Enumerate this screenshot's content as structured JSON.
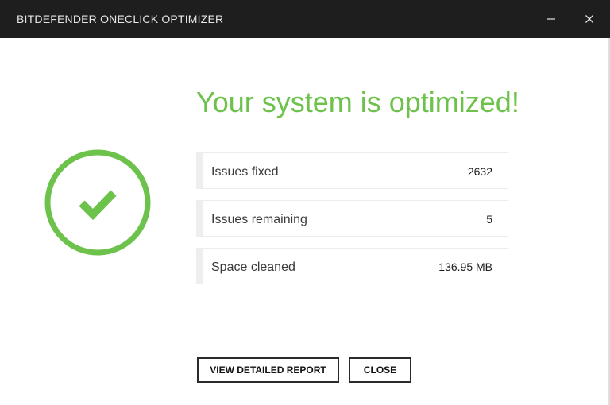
{
  "window": {
    "title": "BITDEFENDER ONECLICK OPTIMIZER",
    "minimize_icon": "minimize-icon",
    "close_icon": "close-icon"
  },
  "main": {
    "headline": "Your system is optimized!",
    "status_icon": "checkmark-circle-icon",
    "stats": [
      {
        "label": "Issues fixed",
        "value": "2632"
      },
      {
        "label": "Issues remaining",
        "value": "5"
      },
      {
        "label": "Space cleaned",
        "value": "136.95 MB"
      }
    ]
  },
  "actions": {
    "report_label": "VIEW DETAILED REPORT",
    "close_label": "CLOSE"
  },
  "colors": {
    "accent": "#6cc24a",
    "titlebar": "#1e1e1e"
  }
}
